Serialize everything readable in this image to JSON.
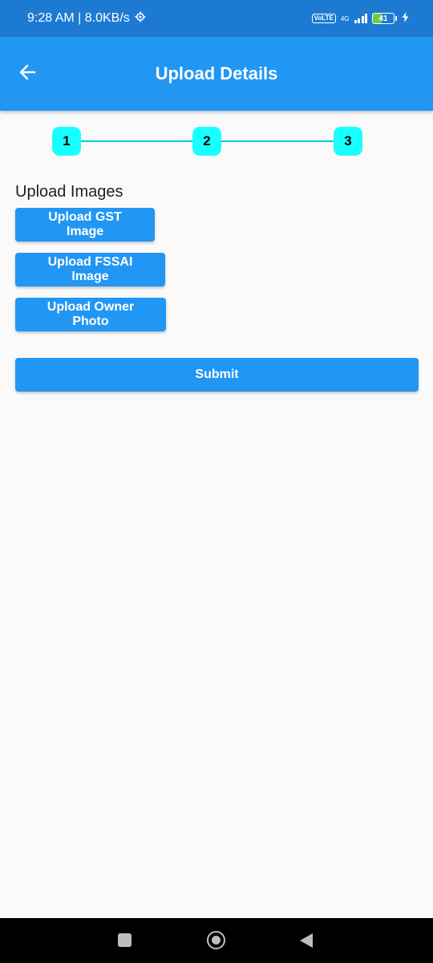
{
  "status_bar": {
    "time_speed": "9:28 AM | 8.0KB/s",
    "settings_icon": "gear-icon",
    "volte": "VoLTE",
    "network": "4G",
    "battery_level": "41",
    "battery_fraction": 0.41,
    "charging_icon": "bolt-icon"
  },
  "app_bar": {
    "title": "Upload Details",
    "back_icon": "arrow-left-icon",
    "background": "#2196f3"
  },
  "stepper": {
    "steps": [
      "1",
      "2",
      "3"
    ],
    "color": "#18ffff"
  },
  "main": {
    "section_label": "Upload Images",
    "buttons": {
      "gst": "Upload GST Image",
      "fssai": "Upload FSSAI Image",
      "owner": "Upload Owner Photo",
      "submit": "Submit"
    }
  },
  "nav_bar": {
    "recent_icon": "square-icon",
    "home_icon": "circle-icon",
    "back_icon": "triangle-back-icon"
  }
}
